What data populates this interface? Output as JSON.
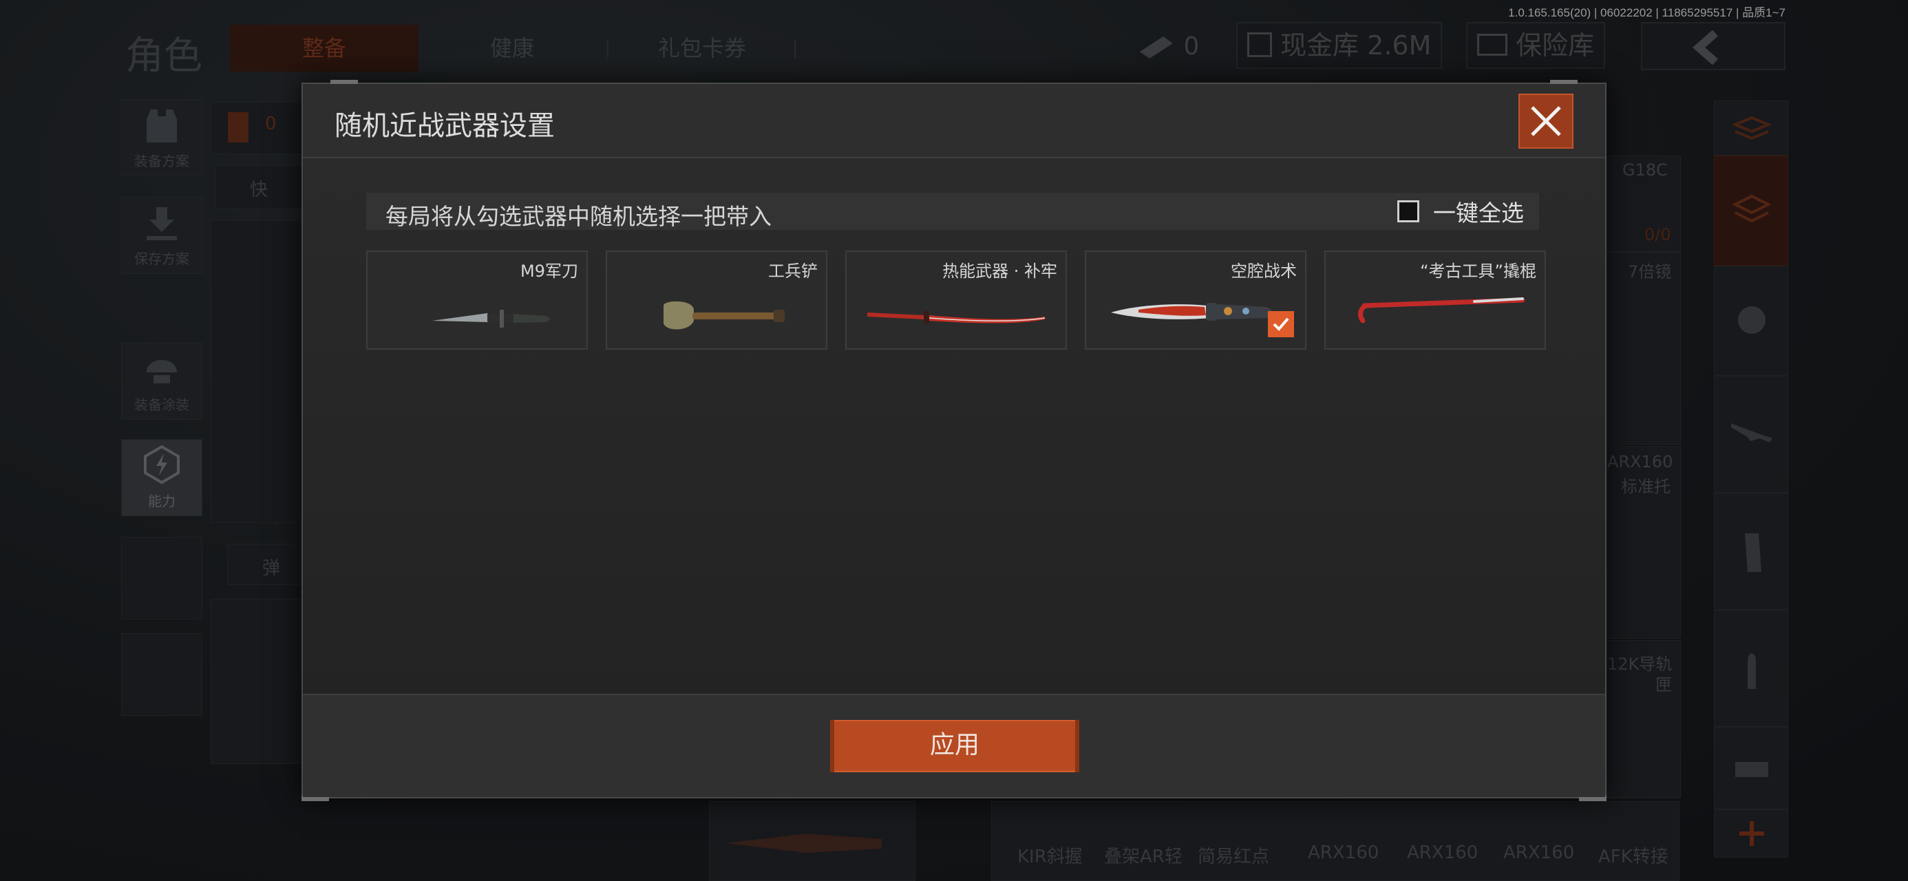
{
  "version_text": "1.0.165.165(20) | 06022202 | 11865295517 | 品质1~7",
  "background": {
    "role_title": "角色",
    "tabs": [
      {
        "label": "整备",
        "active": true
      },
      {
        "label": "健康",
        "active": false
      },
      {
        "label": "礼包卡券",
        "active": false
      }
    ],
    "currency_count": "0",
    "cash_vault": "现金库 2.6M",
    "safe_box": "保险库",
    "left_side": [
      {
        "label": "装备方案",
        "icon": "vest-icon"
      },
      {
        "label": "保存方案",
        "icon": "download-icon"
      },
      {
        "label": "装备涂装",
        "icon": "helmet-icon"
      },
      {
        "label": "能力",
        "icon": "ability-icon",
        "active": true
      }
    ],
    "armor_count": "0",
    "quick_label": "快",
    "ammo_label": "弹",
    "right_texts": {
      "gun_name": "G18C",
      "ammo_ratio": "0/0",
      "scope": "7倍镜",
      "arx_line1": "ARX160",
      "arx_line2": "标准托",
      "rail_line1": "12K导轨",
      "rail_line2": "匣"
    },
    "bottom_labels": [
      "KIR斜握",
      "叠架AR轻",
      "简易红点",
      "ARX160",
      "ARX160",
      "ARX160",
      "AFK转接"
    ]
  },
  "modal": {
    "title": "随机近战武器设置",
    "info_text": "每局将从勾选武器中随机选择一把带入",
    "select_all_label": "一键全选",
    "select_all_checked": false,
    "weapons": [
      {
        "name": "M9军刀",
        "icon": "bayonet-icon",
        "checked": false
      },
      {
        "name": "工兵铲",
        "icon": "shovel-icon",
        "checked": false
      },
      {
        "name": "热能武器 · 补牢",
        "icon": "katana-icon",
        "checked": false
      },
      {
        "name": "空腔战术",
        "icon": "tactical-knife-icon",
        "checked": true
      },
      {
        "name": "“考古工具”撬棍",
        "icon": "crowbar-icon",
        "checked": false
      }
    ],
    "apply_label": "应用",
    "colors": {
      "accent": "#b84a22",
      "check": "#e05c2a",
      "panel": "#262626"
    }
  }
}
